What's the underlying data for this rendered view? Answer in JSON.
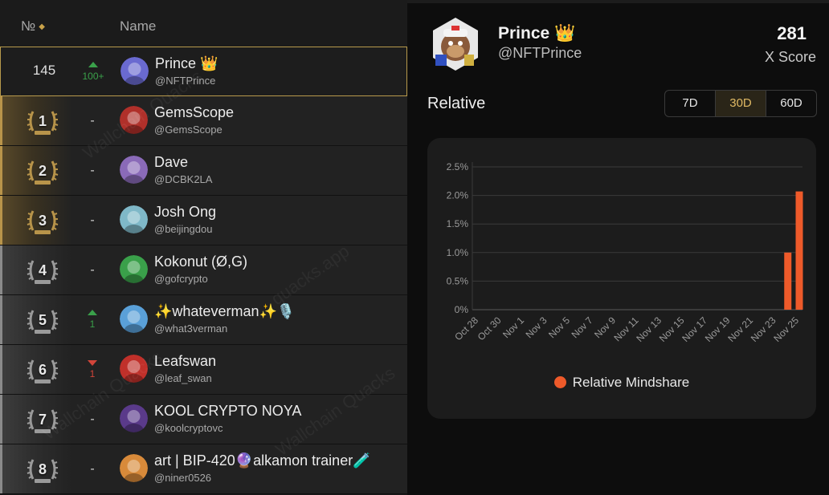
{
  "table": {
    "header": {
      "rank_label": "№",
      "name_label": "Name"
    },
    "highlight_row": {
      "rank": "145",
      "change": "100+",
      "name": "Prince 👑",
      "handle": "@NFTPrince",
      "avatar_color": "#6a6ad0"
    },
    "rows": [
      {
        "rank": "1",
        "change": "-",
        "name": "GemsScope",
        "handle": "@GemsScope",
        "tier": "gold",
        "avatar_color": "#b0302a"
      },
      {
        "rank": "2",
        "change": "-",
        "name": "Dave",
        "handle": "@DCBK2LA",
        "tier": "gold",
        "avatar_color": "#8a6ab8"
      },
      {
        "rank": "3",
        "change": "-",
        "name": "Josh Ong",
        "handle": "@beijingdou",
        "tier": "gold",
        "avatar_color": "#7fb8c8"
      },
      {
        "rank": "4",
        "change": "-",
        "name": "Kokonut (Ø,G)",
        "handle": "@gofcrypto",
        "tier": "silver",
        "avatar_color": "#3aa04a"
      },
      {
        "rank": "5",
        "change": "1",
        "direction": "up",
        "name": "✨whateverman✨🎙️",
        "handle": "@what3verman",
        "tier": "silver",
        "avatar_color": "#5aa0d8"
      },
      {
        "rank": "6",
        "change": "1",
        "direction": "down",
        "name": "Leafswan",
        "handle": "@leaf_swan",
        "tier": "silver",
        "avatar_color": "#c0302a"
      },
      {
        "rank": "7",
        "change": "-",
        "name": "KOOL CRYPTO NOYA",
        "handle": "@koolcryptovc",
        "tier": "silver",
        "avatar_color": "#5a3a8a"
      },
      {
        "rank": "8",
        "change": "-",
        "name": "art | BIP-420🔮alkamon trainer🧪",
        "handle": "@niner0526",
        "tier": "silver",
        "avatar_color": "#d88a3a"
      }
    ]
  },
  "profile": {
    "name": "Prince 👑",
    "handle": "@NFTPrince",
    "score": "281",
    "score_label": "X Score"
  },
  "relative": {
    "title": "Relative",
    "ranges": [
      "7D",
      "30D",
      "60D"
    ],
    "active_range": "30D"
  },
  "chart_data": {
    "type": "bar",
    "title": "",
    "xlabel": "",
    "ylabel": "",
    "x_ticks": [
      "Oct 28",
      "Oct 30",
      "Nov 1",
      "Nov 3",
      "Nov 5",
      "Nov 7",
      "Nov 9",
      "Nov 11",
      "Nov 13",
      "Nov 15",
      "Nov 17",
      "Nov 19",
      "Nov 21",
      "Nov 23",
      "Nov 25"
    ],
    "y_ticks": [
      "0%",
      "0.5%",
      "1.0%",
      "1.5%",
      "2.0%",
      "2.5%"
    ],
    "ylim": [
      0,
      2.5
    ],
    "grid": true,
    "legend_position": "bottom",
    "series": [
      {
        "name": "Relative Mindshare",
        "color": "#ee5a2a",
        "points": [
          {
            "x": "Nov 24",
            "y": 1.0
          },
          {
            "x": "Nov 25",
            "y": 2.07
          }
        ]
      }
    ]
  }
}
